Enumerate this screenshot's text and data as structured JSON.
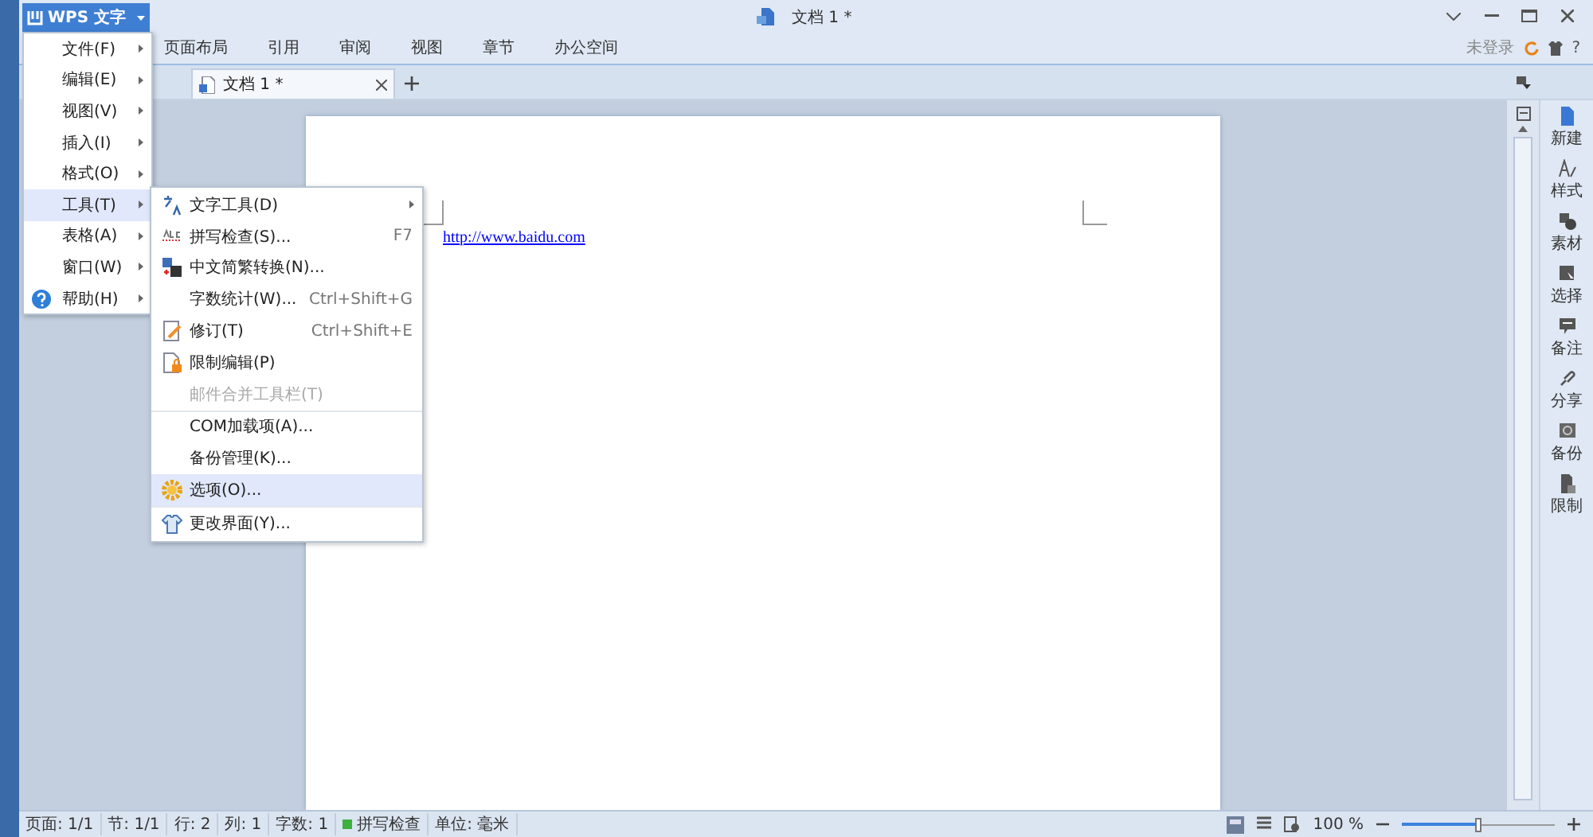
{
  "app_button": {
    "label": "WPS 文字"
  },
  "window": {
    "title": "文档 1 *"
  },
  "ribbon_tabs": [
    {
      "label": "页面布局",
      "selected": false
    },
    {
      "label": "引用",
      "selected": false
    },
    {
      "label": "审阅",
      "selected": false
    },
    {
      "label": "视图",
      "selected": false
    },
    {
      "label": "章节",
      "selected": false
    },
    {
      "label": "办公空间",
      "selected": false
    }
  ],
  "login": "未登录",
  "help": "?",
  "doc_tabs": [
    {
      "label": "文档 1 *",
      "selected": true
    }
  ],
  "document": {
    "link": "http://www.baidu.com"
  },
  "main_menu": [
    {
      "label": "文件(F)",
      "selected": false,
      "kind": "plain"
    },
    {
      "label": "编辑(E)",
      "selected": false,
      "kind": "plain"
    },
    {
      "label": "视图(V)",
      "selected": false,
      "kind": "plain"
    },
    {
      "label": "插入(I)",
      "selected": false,
      "kind": "plain"
    },
    {
      "label": "格式(O)",
      "selected": false,
      "kind": "plain"
    },
    {
      "label": "工具(T)",
      "selected": true,
      "kind": "plain"
    },
    {
      "label": "表格(A)",
      "selected": false,
      "kind": "plain"
    },
    {
      "label": "窗口(W)",
      "selected": false,
      "kind": "plain"
    },
    {
      "label": "帮助(H)",
      "selected": false,
      "kind": "help"
    }
  ],
  "tools_menu": [
    {
      "label": "文字工具(D)",
      "kind": "text",
      "submenu": true,
      "selected": false,
      "disabled": false,
      "separator_before": false
    },
    {
      "label": "拼写检查(S)...",
      "kind": "abc",
      "shortcut": "F7",
      "submenu": false,
      "selected": false,
      "disabled": false,
      "separator_before": false
    },
    {
      "label": "中文简繁转换(N)...",
      "kind": "convert",
      "submenu": false,
      "selected": false,
      "disabled": false,
      "separator_before": false
    },
    {
      "label": "字数统计(W)...",
      "kind": "plain",
      "shortcut": "Ctrl+Shift+G",
      "submenu": false,
      "selected": false,
      "disabled": false,
      "separator_before": false
    },
    {
      "label": "修订(T)",
      "kind": "pencil",
      "shortcut": "Ctrl+Shift+E",
      "submenu": false,
      "selected": false,
      "disabled": false,
      "separator_before": false
    },
    {
      "label": "限制编辑(P)",
      "kind": "lock",
      "submenu": false,
      "selected": false,
      "disabled": false,
      "separator_before": false
    },
    {
      "label": "邮件合并工具栏(T)",
      "kind": "plain",
      "submenu": false,
      "selected": false,
      "disabled": true,
      "separator_before": false
    },
    {
      "label": "COM加载项(A)...",
      "kind": "plain",
      "submenu": false,
      "selected": false,
      "disabled": false,
      "separator_before": true
    },
    {
      "label": "备份管理(K)...",
      "kind": "plain",
      "submenu": false,
      "selected": false,
      "disabled": false,
      "separator_before": false
    },
    {
      "label": "选项(O)...",
      "kind": "gear",
      "submenu": false,
      "selected": true,
      "disabled": false,
      "separator_before": false
    },
    {
      "label": "更改界面(Y)...",
      "kind": "shirt",
      "submenu": false,
      "selected": false,
      "disabled": false,
      "separator_before": true
    }
  ],
  "side_panel": [
    {
      "label": "新建",
      "kind": "page"
    },
    {
      "label": "样式",
      "kind": "style"
    },
    {
      "label": "素材",
      "kind": "shapes"
    },
    {
      "label": "选择",
      "kind": "select"
    },
    {
      "label": "备注",
      "kind": "comment"
    },
    {
      "label": "分享",
      "kind": "link"
    },
    {
      "label": "备份",
      "kind": "backup"
    },
    {
      "label": "限制",
      "kind": "lock"
    }
  ],
  "status_bar": {
    "items": [
      {
        "label": "页面: 1/1",
        "kind": "text"
      },
      {
        "label": "节: 1/1",
        "kind": "text"
      },
      {
        "label": "行: 2",
        "kind": "text"
      },
      {
        "label": "列: 1",
        "kind": "text"
      },
      {
        "label": "字数: 1",
        "kind": "text"
      },
      {
        "label": "拼写检查",
        "kind": "spell"
      },
      {
        "label": "单位: 毫米",
        "kind": "text"
      }
    ],
    "zoom": "100 %",
    "zoom_slider": {
      "level": 0.5
    }
  }
}
